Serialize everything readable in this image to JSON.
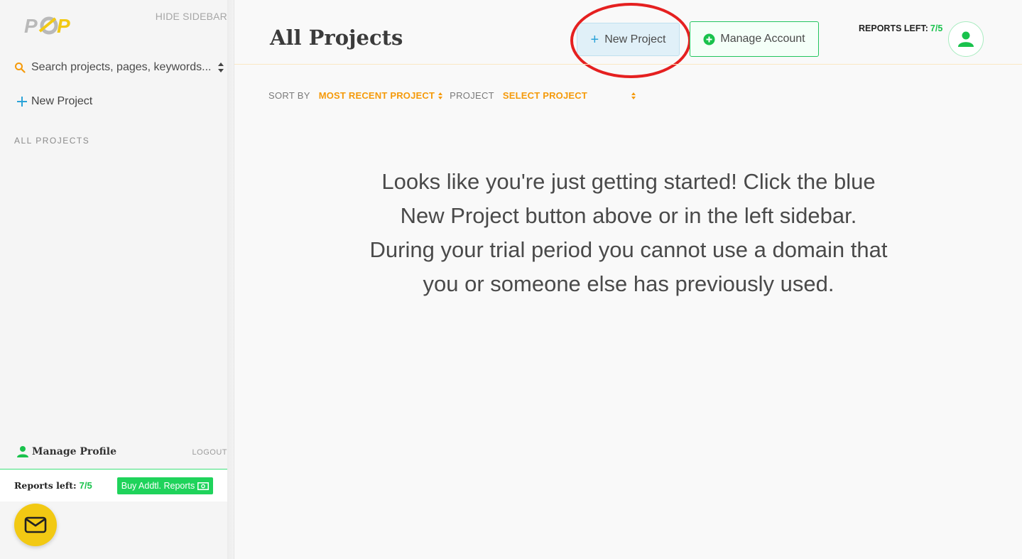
{
  "colors": {
    "accent_orange": "#f59a0a",
    "accent_green": "#19c24c",
    "accent_blue": "#2ba3d8",
    "highlight_red": "#e52020",
    "fab_yellow": "#f2c913"
  },
  "sidebar": {
    "logo_text": "POP",
    "hide_sidebar": "HIDE SIDEBAR",
    "search_placeholder": "Search projects, pages, keywords...",
    "new_project": "New Project",
    "all_projects": "ALL PROJECTS",
    "manage_profile": "Manage Profile",
    "logout": "LOGOUT",
    "reports_left_label": "Reports left:",
    "reports_left_value": "7/5",
    "buy_reports": "Buy Addtl. Reports",
    "icons": [
      "search-icon",
      "sort-arrows-icon",
      "plus-icon",
      "user-icon",
      "money-icon",
      "mail-icon"
    ]
  },
  "header": {
    "title": "All Projects",
    "new_project_button": "New Project",
    "manage_account_button": "Manage Account",
    "reports_left_label": "REPORTS LEFT:",
    "reports_left_value": "7/5"
  },
  "filters": {
    "sort_by_label": "SORT BY",
    "sort_by_value": "MOST RECENT PROJECT",
    "project_label": "PROJECT",
    "project_value": "SELECT PROJECT"
  },
  "empty_state": {
    "line1": "Looks like you're just getting started! Click the blue New Project button above or in the left sidebar.",
    "line2": "During your trial period you cannot use a domain that you or someone else has previously used."
  }
}
